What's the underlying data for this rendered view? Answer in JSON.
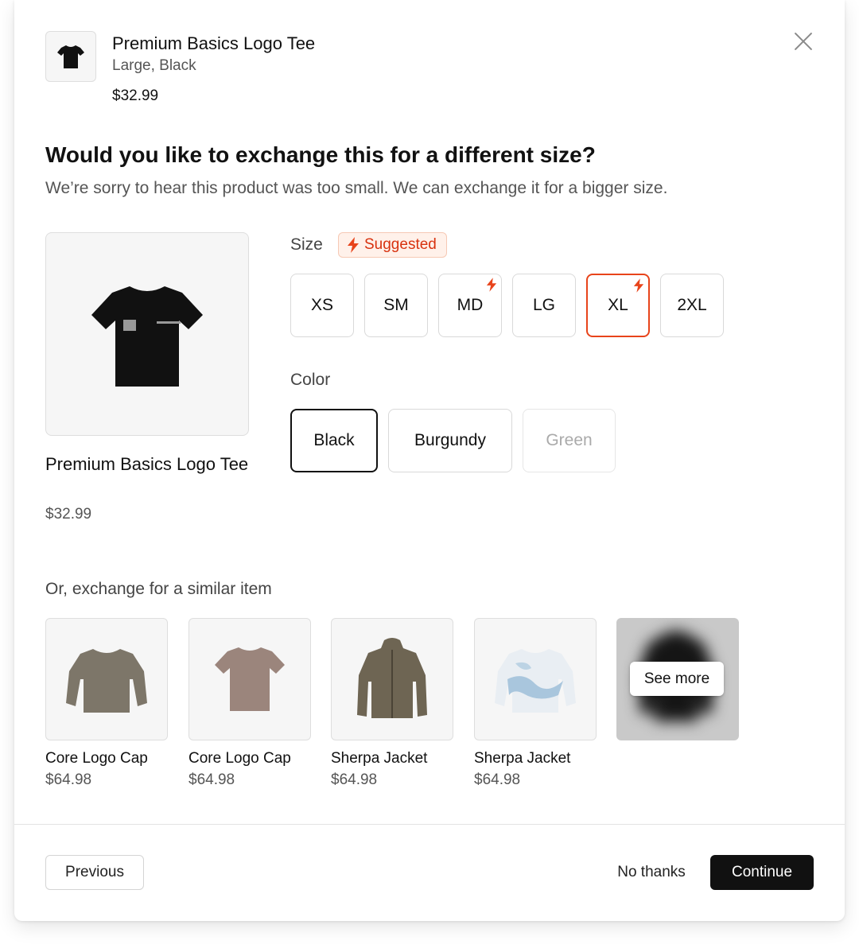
{
  "header": {
    "product_name": "Premium Basics Logo Tee",
    "variant": "Large, Black",
    "price": "$32.99"
  },
  "question": {
    "title": "Would you like to exchange this for a different size?",
    "subtitle": "We’re sorry to hear this product was too small. We can exchange it for a bigger size."
  },
  "product": {
    "name": "Premium Basics Logo Tee",
    "price": "$32.99"
  },
  "size": {
    "label": "Size",
    "badge": "Suggested",
    "options": [
      {
        "label": "XS",
        "suggested": false,
        "selected": false
      },
      {
        "label": "SM",
        "suggested": false,
        "selected": false
      },
      {
        "label": "MD",
        "suggested": true,
        "selected": false
      },
      {
        "label": "LG",
        "suggested": false,
        "selected": false
      },
      {
        "label": "XL",
        "suggested": true,
        "selected": true
      },
      {
        "label": "2XL",
        "suggested": false,
        "selected": false
      }
    ]
  },
  "color": {
    "label": "Color",
    "options": [
      {
        "label": "Black",
        "selected": true,
        "available": true
      },
      {
        "label": "Burgundy",
        "selected": false,
        "available": true
      },
      {
        "label": "Green",
        "selected": false,
        "available": false
      }
    ]
  },
  "similar": {
    "label": "Or, exchange for a similar item",
    "items": [
      {
        "name": "Core Logo Cap",
        "price": "$64.98",
        "icon": "sweatshirt-image"
      },
      {
        "name": "Core Logo Cap",
        "price": "$64.98",
        "icon": "tshirt-image"
      },
      {
        "name": "Sherpa Jacket",
        "price": "$64.98",
        "icon": "jacket-image"
      },
      {
        "name": "Sherpa Jacket",
        "price": "$64.98",
        "icon": "tie-dye-sweater-image"
      }
    ],
    "see_more": "See more"
  },
  "footer": {
    "previous": "Previous",
    "no_thanks": "No thanks",
    "continue": "Continue"
  },
  "colors": {
    "accent": "#e8441b",
    "primary_button": "#111111"
  }
}
